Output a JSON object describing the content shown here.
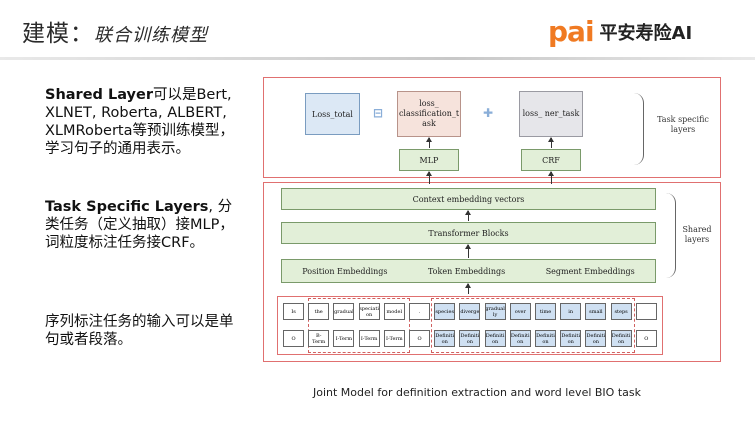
{
  "header": {
    "title": "建模：",
    "subtitle": "联合训练模型",
    "logo_mark": "pai",
    "logo_name": "平安寿险AI"
  },
  "text": {
    "p1_bold": "Shared Layer",
    "p1_rest": "可以是Bert, XLNET, Roberta, ALBERT, XLMRoberta等预训练模型，学习句子的通用表示。",
    "p2_bold": "Task Specific Layers",
    "p2_rest": ", 分类任务（定义抽取）接MLP，词粒度标注任务接CRF。",
    "p3": "序列标注任务的输入可以是单句或者段落。"
  },
  "diagram": {
    "loss_total": "Loss_total",
    "op_equal": "⊟",
    "loss_cls": "loss_ classification_t ask",
    "op_plus": "✚",
    "loss_ner": "loss_ ner_task",
    "mlp": "MLP",
    "crf": "CRF",
    "task_label": "Task specific layers",
    "context": "Context embedding vectors",
    "transformer": "Transformer Blocks",
    "emb_pos": "Position Embeddings",
    "emb_tok": "Token Embeddings",
    "emb_seg": "Segment Embeddings",
    "shared_label": "Shared layers",
    "tokens_top": [
      "Is",
      "the",
      "gradual",
      "speciati on",
      "model",
      ".",
      "species",
      "diverge",
      "gradual ly",
      "over",
      "time",
      "in",
      "small",
      "steps",
      ""
    ],
    "tokens_bottom": [
      "O",
      "B- Term",
      "I-Term",
      "I-Term",
      "I-Term",
      "O",
      "Definiti on",
      "Definiti on",
      "Definiti on",
      "Definiti on",
      "Definiti on",
      "Definiti on",
      "Definiti on",
      "Definiti on",
      "O"
    ]
  },
  "caption": "Joint Model for definition extraction and word level BIO task",
  "colors": {
    "accent_orange": "#f07a22",
    "box_border": "#e07070",
    "blue_fill": "#dce8f5",
    "green_fill": "#e2efd8"
  }
}
